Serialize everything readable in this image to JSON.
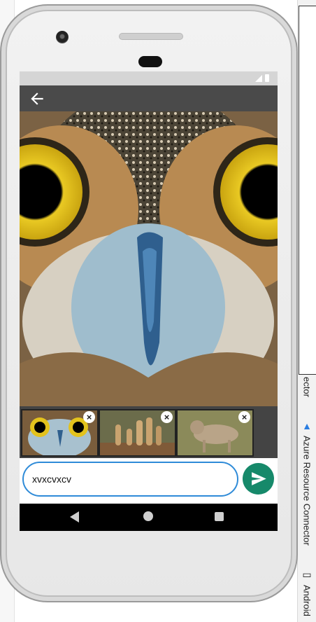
{
  "ide": {
    "right_tools": [
      {
        "label": "Azure Resource Connector",
        "icon": "azure-icon"
      },
      {
        "label": "Android",
        "icon": "android-device-icon"
      }
    ],
    "partial_label": "ector"
  },
  "app": {
    "appbar": {
      "back_icon": "arrow-back-icon"
    },
    "main_image": {
      "subject": "owl"
    },
    "thumbnails": [
      {
        "subject": "owl"
      },
      {
        "subject": "meerkats"
      },
      {
        "subject": "coyote"
      }
    ],
    "composer": {
      "input_value": "xvxcvxcv",
      "send_icon": "send-icon"
    },
    "colors": {
      "appbar": "#4a4a4a",
      "send": "#16896a",
      "input_border": "#2f8bd8"
    }
  }
}
